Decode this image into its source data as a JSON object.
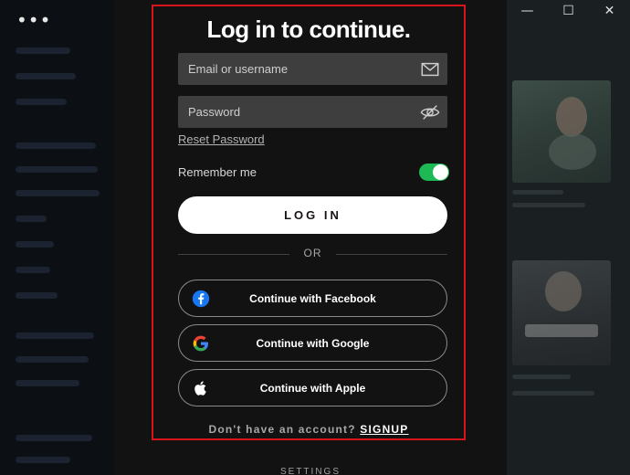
{
  "window": {
    "menu_dots": "•••",
    "controls": {
      "minimize": "—",
      "maximize": "☐",
      "close": "✕"
    }
  },
  "login": {
    "title": "Log in to continue.",
    "email_placeholder": "Email or username",
    "password_placeholder": "Password",
    "reset_password": "Reset Password",
    "remember_me": "Remember me",
    "remember_me_on": true,
    "login_button": "LOG IN",
    "divider": "OR",
    "facebook": "Continue with Facebook",
    "google": "Continue with Google",
    "apple": "Continue with Apple",
    "signup_prompt": "Don't have an account?",
    "signup_link": "SIGNUP"
  },
  "footer": {
    "settings": "SETTINGS"
  },
  "colors": {
    "panel_border": "#d8141a",
    "toggle_on": "#1db954",
    "facebook_blue": "#1877f2",
    "field_bg": "#3e3e3e"
  }
}
